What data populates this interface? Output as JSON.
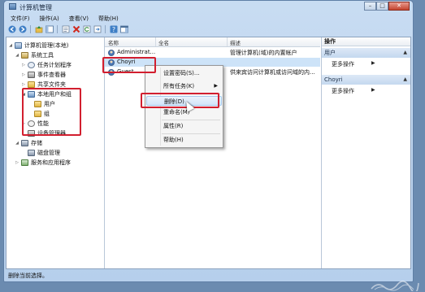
{
  "window": {
    "title": "计算机管理",
    "buttons": {
      "minimize": "–",
      "maximize": "□",
      "close": "✕"
    }
  },
  "menubar": {
    "items": [
      "文件(F)",
      "操作(A)",
      "查看(V)",
      "帮助(H)"
    ]
  },
  "toolbar": {
    "icons": [
      "back-icon",
      "forward-icon",
      "up-folder-icon",
      "show-hide-tree-icon",
      "properties-icon",
      "delete-icon",
      "refresh-icon",
      "export-icon",
      "help-icon",
      "console-icon"
    ]
  },
  "tree": {
    "items": [
      {
        "label": "计算机管理(本地)",
        "icon": "computer-icon",
        "expanded": true
      },
      {
        "label": "系统工具",
        "icon": "tools-icon",
        "expanded": true
      },
      {
        "label": "任务计划程序",
        "icon": "clock-icon"
      },
      {
        "label": "事件查看器",
        "icon": "event-viewer-icon"
      },
      {
        "label": "共享文件夹",
        "icon": "shared-folder-icon"
      },
      {
        "label": "本地用户和组",
        "icon": "users-icon",
        "expanded": true
      },
      {
        "label": "用户",
        "icon": "folder-icon",
        "selected": true
      },
      {
        "label": "组",
        "icon": "folder-icon"
      },
      {
        "label": "性能",
        "icon": "performance-icon"
      },
      {
        "label": "设备管理器",
        "icon": "device-manager-icon"
      },
      {
        "label": "存储",
        "icon": "storage-icon",
        "expanded": true
      },
      {
        "label": "磁盘管理",
        "icon": "disk-icon"
      },
      {
        "label": "服务和应用程序",
        "icon": "services-icon"
      }
    ]
  },
  "list": {
    "columns": [
      "名称",
      "全名",
      "描述"
    ],
    "rows": [
      {
        "name": "Administrat...",
        "fullname": "",
        "description": "管理计算机(域)的内置帐户"
      },
      {
        "name": "Choyri",
        "fullname": "",
        "description": "",
        "selected": true
      },
      {
        "name": "Guest",
        "fullname": "",
        "description": "供来宾访问计算机或访问域的内..."
      }
    ]
  },
  "context_menu": {
    "items": [
      {
        "label": "设置密码(S)..."
      },
      {
        "label": "所有任务(K)",
        "submenu": "▶"
      },
      {
        "label": "删除(D)",
        "hover": true
      },
      {
        "label": "重命名(M)"
      },
      {
        "label": "属性(R)"
      },
      {
        "label": "帮助(H)"
      }
    ]
  },
  "actions": {
    "header": "操作",
    "sections": [
      {
        "title": "用户",
        "chevron": "▲",
        "items": [
          {
            "label": "更多操作",
            "submenu": "▶"
          }
        ]
      },
      {
        "title": "Choyri",
        "chevron": "▲",
        "items": [
          {
            "label": "更多操作",
            "submenu": "▶"
          }
        ]
      }
    ]
  },
  "statusbar": {
    "text": "删除当前选择。"
  },
  "colors": {
    "highlight_box": "#d21f2f",
    "selection": "#cde3f8",
    "title_bar": "#c8dcf2"
  }
}
